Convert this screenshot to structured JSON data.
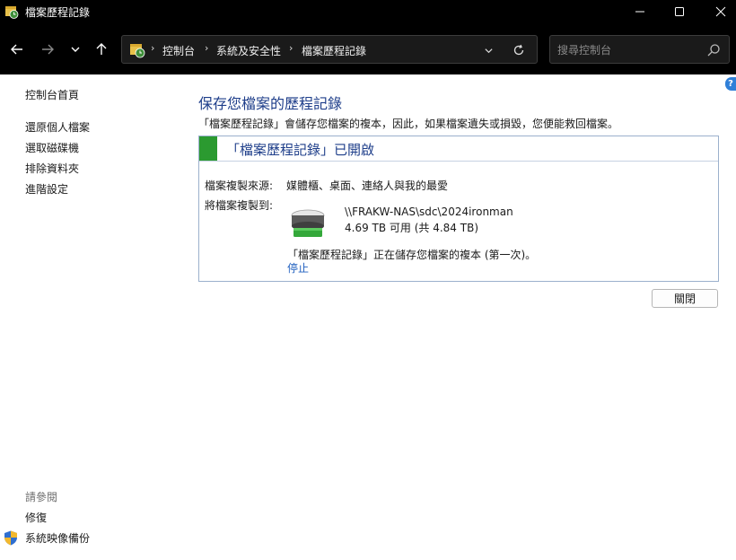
{
  "window": {
    "title": "檔案歷程記錄"
  },
  "address": {
    "breadcrumbs": [
      "控制台",
      "系統及安全性",
      "檔案歷程記錄"
    ]
  },
  "search": {
    "placeholder": "搜尋控制台"
  },
  "help_label": "?",
  "sidebar": {
    "links": [
      "控制台首頁",
      "還原個人檔案",
      "選取磁碟機",
      "排除資料夾",
      "進階設定"
    ],
    "see_also_heading": "請參閱",
    "see_also_links": [
      "修復",
      "系統映像備份"
    ]
  },
  "main": {
    "title": "保存您檔案的歷程記錄",
    "description": "「檔案歷程記錄」會儲存您檔案的複本，因此，如果檔案遺失或損毀，您便能救回檔案。",
    "status": {
      "text": "「檔案歷程記錄」已開啟",
      "color": "#2b9a30"
    },
    "source_label": "檔案複製來源:",
    "source_value": "媒體櫃、桌面、連絡人與我的最愛",
    "destination_label": "將檔案複製到:",
    "destination_path": "\\\\FRAKW-NAS\\sdc\\2024ironman",
    "destination_space": "4.69 TB 可用 (共 4.84 TB)",
    "progress_text": "「檔案歷程記錄」正在儲存您檔案的複本 (第一次)。",
    "stop_label": "停止",
    "close_label": "關閉"
  },
  "colors": {
    "accent": "#1e3e8a",
    "link": "#1f5fbf"
  }
}
